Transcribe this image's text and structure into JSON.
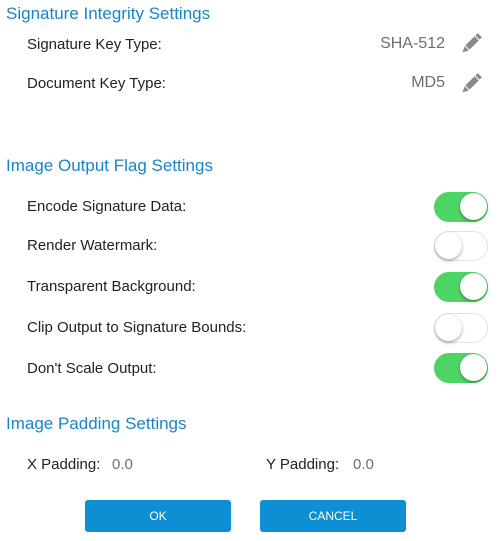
{
  "colors": {
    "section_title": "#1a84c4",
    "toggle_on": "#4cd564",
    "toggle_off_border": "#e2e2e2",
    "button_bg": "#0e8fd4",
    "value_text": "#6e6e6e"
  },
  "signature_integrity": {
    "title": "Signature Integrity Settings",
    "rows": [
      {
        "label": "Signature Key Type:",
        "value": "SHA-512",
        "icon": "pencil-icon"
      },
      {
        "label": "Document Key Type:",
        "value": "MD5",
        "icon": "pencil-icon"
      }
    ]
  },
  "image_output": {
    "title": "Image Output Flag Settings",
    "toggles": [
      {
        "label": "Encode Signature Data:",
        "on": true
      },
      {
        "label": "Render Watermark:",
        "on": false
      },
      {
        "label": "Transparent Background:",
        "on": true
      },
      {
        "label": "Clip Output to Signature Bounds:",
        "on": false
      },
      {
        "label": "Don't Scale Output:",
        "on": true
      }
    ]
  },
  "image_padding": {
    "title": "Image Padding Settings",
    "x_label": "X Padding:",
    "x_value": "0.0",
    "y_label": "Y Padding:",
    "y_value": "0.0"
  },
  "buttons": {
    "ok_label": "OK",
    "cancel_label": "CANCEL"
  }
}
